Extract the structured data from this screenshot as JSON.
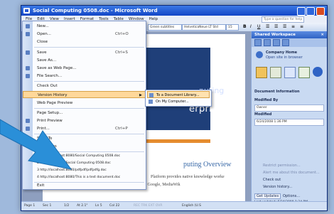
{
  "window": {
    "title": "Social Computing 0508.doc - Microsoft Word"
  },
  "menubar": {
    "items": [
      "File",
      "Edit",
      "View",
      "Insert",
      "Format",
      "Tools",
      "Table",
      "Window",
      "Help"
    ],
    "help_placeholder": "Type a question for help"
  },
  "toolbar": {
    "style": "Green subtitles",
    "font": "HelveticaNeue LT Std",
    "size": "15"
  },
  "file_menu": {
    "items": [
      {
        "label": "New...",
        "shortcut": ""
      },
      {
        "label": "Open...",
        "shortcut": "Ctrl+O"
      },
      {
        "label": "Close",
        "shortcut": ""
      },
      {
        "label": "Save",
        "shortcut": "Ctrl+S"
      },
      {
        "label": "Save As...",
        "shortcut": ""
      },
      {
        "label": "Save as Web Page...",
        "shortcut": ""
      },
      {
        "label": "File Search...",
        "shortcut": ""
      },
      {
        "label": "Check Out",
        "shortcut": ""
      },
      {
        "label": "Version History",
        "shortcut": ""
      },
      {
        "label": "Web Page Preview",
        "shortcut": ""
      },
      {
        "label": "Page Setup...",
        "shortcut": ""
      },
      {
        "label": "Print Preview",
        "shortcut": ""
      },
      {
        "label": "Print...",
        "shortcut": "Ctrl+P"
      },
      {
        "label": "Send To",
        "shortcut": ""
      },
      {
        "label": "Properties",
        "shortcut": ""
      },
      {
        "label": "1 http://localhost:8080/Social Computing 0508.doc",
        "shortcut": ""
      },
      {
        "label": "2 http://localhost/Social Computing 0508.doc",
        "shortcut": ""
      },
      {
        "label": "3 http://localhost:8080/pdfpdf/pdfpdfg.doc",
        "shortcut": ""
      },
      {
        "label": "4 http://localhost:8080/This is a test document.doc",
        "shortcut": ""
      },
      {
        "label": "Exit",
        "shortcut": ""
      }
    ]
  },
  "submenu": {
    "items": [
      "To a Document Library...",
      "On My Computer..."
    ]
  },
  "document": {
    "heading1": "puting",
    "heading2": "erprise",
    "subheading": "puting Overview",
    "line1": "Platform provides native knowledge worke",
    "line2": "integration to leading Web 2.0 tools and services such as Facebook, Google, MediaWik"
  },
  "taskpane": {
    "title": "Shared Workspace",
    "home_label": "Company Home",
    "home_link": "Open site in browser",
    "section": "Document Information",
    "modified_by_label": "Modified By",
    "modified_by_value": "Owner",
    "modified_label": "Modified",
    "modified_value": "6/24/2008 1:36 PM",
    "link1": "Restrict permission...",
    "link2": "Alert me about this document...",
    "link3": "Check out",
    "link4": "Version history...",
    "get_updates": "Get Updates",
    "options": "Options...",
    "last_updated": "Last updated: 6/24/2008 1:34 PM"
  },
  "statusbar": {
    "page": "Page 1",
    "sec": "Sec 1",
    "pos": "1/2",
    "at": "At 2.1\"",
    "ln": "Ln 5",
    "col": "Col 22",
    "flags": "REC TRK EXT OVR",
    "lang": "English (U.S"
  },
  "colors": {
    "accent": "#1f3f79",
    "highlight": "#ffd89a",
    "arrow": "#2a8fd8"
  }
}
